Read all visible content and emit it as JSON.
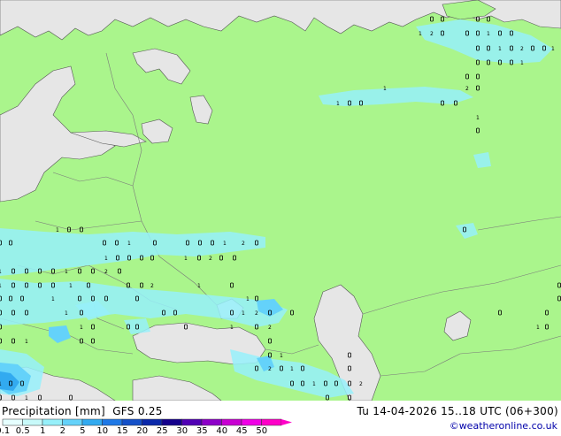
{
  "legend": {
    "title": "Precipitation [mm]",
    "model": "GFS 0.25",
    "ticks": [
      "0.1",
      "0.5",
      "1",
      "2",
      "5",
      "10",
      "15",
      "20",
      "25",
      "30",
      "35",
      "40",
      "45",
      "50"
    ],
    "colors": [
      "#e6ffff",
      "#c8fafa",
      "#96f0fa",
      "#64d2fa",
      "#32aaf0",
      "#1e78e6",
      "#1450c8",
      "#0a28aa",
      "#14008c",
      "#5000b4",
      "#8c00c8",
      "#c800d2",
      "#f000e6",
      "#ff00c8"
    ]
  },
  "valid_time": "Tu 14-04-2026 15..18 UTC (06+300)",
  "copyright": "©weatheronline.co.uk",
  "colors": {
    "land": "#aaf58c",
    "water": "#e6e6e6",
    "border": "#7a7a7a",
    "coast": "#555555",
    "precip_light": "#96f0fa",
    "precip_medium": "#64d2fa",
    "precip_heavy": "#32aaf0"
  },
  "marker_values": [
    "0",
    "1",
    "2"
  ]
}
